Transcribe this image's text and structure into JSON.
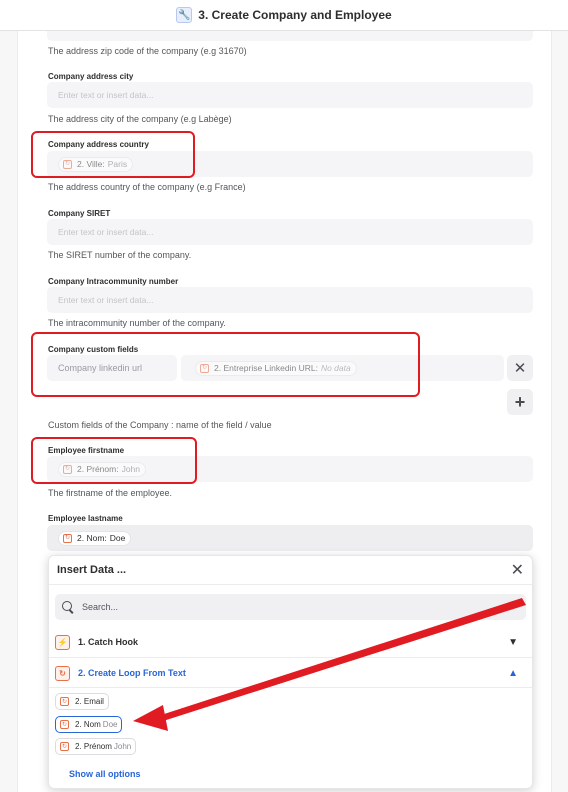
{
  "header": {
    "title": "3. Create Company and Employee",
    "icon": "wrench-icon"
  },
  "fields": {
    "zip_help": "The address zip code of the company (e.g 31670)",
    "city_label": "Company address city",
    "city_placeholder": "Enter text or insert data...",
    "city_help": "The address city of the company (e.g Labège)",
    "country_label": "Company address country",
    "country_chip_step": "2. Ville:",
    "country_chip_value": "Paris",
    "country_help": "The address country of the company (e.g France)",
    "siret_label": "Company SIRET",
    "siret_placeholder": "Enter text or insert data...",
    "siret_help": "The SIRET number of the company.",
    "intra_label": "Company Intracommunity number",
    "intra_placeholder": "Enter text or insert data...",
    "intra_help": "The intracommunity number of the company.",
    "custom_label": "Company custom fields",
    "custom_key": "Company linkedin url",
    "custom_chip_step": "2. Entreprise Linkedin URL:",
    "custom_chip_value": "No data",
    "custom_help": "Custom fields of the Company : name of the field / value",
    "firstname_label": "Employee firstname",
    "firstname_chip_step": "2. Prénom:",
    "firstname_chip_value": "John",
    "firstname_help": "The firstname of the employee.",
    "lastname_label": "Employee lastname",
    "lastname_chip_step": "2. Nom:",
    "lastname_chip_value": "Doe"
  },
  "insert_data": {
    "title": "Insert Data ...",
    "search_placeholder": "Search...",
    "steps": [
      {
        "label": "1. Catch Hook",
        "expanded": false
      },
      {
        "label": "2. Create Loop From Text",
        "expanded": true
      }
    ],
    "options": [
      {
        "name": "2. Email",
        "value": ""
      },
      {
        "name": "2. Nom",
        "value": "Doe",
        "selected": true
      },
      {
        "name": "2. Prénom",
        "value": "John"
      }
    ],
    "show_all": "Show all options"
  },
  "colors": {
    "accent": "#2866d6",
    "highlight": "#e01c22",
    "app_icon": "#e8704a"
  }
}
